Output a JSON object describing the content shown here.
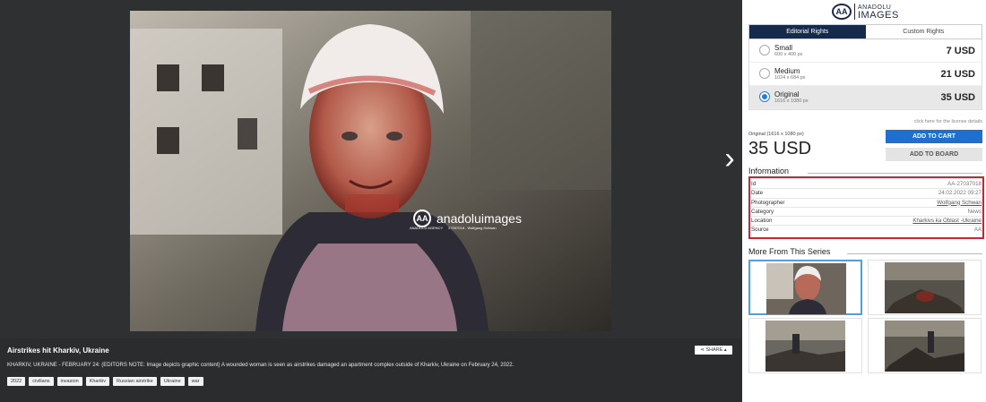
{
  "photo": {
    "watermark_brand": "anadoluimages",
    "watermark_agency": "ANADOLU AGENCY",
    "watermark_id": "27037018 - Wolfgang Schwan"
  },
  "caption": {
    "title": "Airstrikes hit Kharkiv, Ukraine",
    "description": "KHARKIV, UKRAINE - FEBRUARY 24: (EDITORS NOTE: Image depicts graphic content) A wounded woman is seen as airstrikes damaged an apartment complex outside of Kharkiv, Ukraine on February 24, 2022.",
    "share_label": "SHARE",
    "tags": [
      "2022",
      "civilians",
      "invasion",
      "Kharkiv",
      "Russian airstrike",
      "Ukraine",
      "war"
    ]
  },
  "logo": {
    "line1": "ANADOLU",
    "line2": "IMAGES"
  },
  "tabs": [
    {
      "label": "Editorial Rights",
      "active": true
    },
    {
      "label": "Custom Rights",
      "active": false
    }
  ],
  "sizes": [
    {
      "name": "Small",
      "dims": "600 x 400 px",
      "price": "7 USD",
      "selected": false
    },
    {
      "name": "Medium",
      "dims": "1024 x 684 px",
      "price": "21 USD",
      "selected": false
    },
    {
      "name": "Original",
      "dims": "1616 x 1080 px",
      "price": "35 USD",
      "selected": true
    }
  ],
  "license_link": "click here for the license details",
  "selected_summary": {
    "label": "Original (1616 x 1080 px)",
    "price": "35 USD"
  },
  "buttons": {
    "add_to_cart": "ADD TO CART",
    "add_to_board": "ADD TO BOARD"
  },
  "information": {
    "title": "Information",
    "rows": [
      {
        "key": "Id",
        "value": "AA-27037018",
        "link": false
      },
      {
        "key": "Date",
        "value": "24.02.2022 09:27",
        "link": false
      },
      {
        "key": "Photographer",
        "value": "Wolfgang Schwan",
        "link": true
      },
      {
        "key": "Category",
        "value": "News",
        "link": false
      },
      {
        "key": "Location",
        "value": "Kharkivs ka Oblast -Ukraine",
        "link": true
      },
      {
        "key": "Source",
        "value": "AA",
        "link": false
      }
    ]
  },
  "series": {
    "title": "More From This Series"
  },
  "colors": {
    "accent": "#1f6fd1",
    "tab_active": "#162a4c",
    "highlight_border": "#d32132"
  }
}
